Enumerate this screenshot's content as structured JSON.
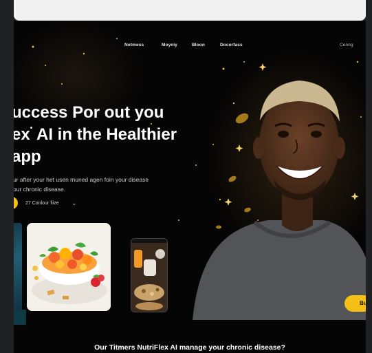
{
  "nav": {
    "items": [
      {
        "label": "Notmess"
      },
      {
        "label": "Moyniy"
      },
      {
        "label": "Bloon"
      },
      {
        "label": "Docorfass"
      }
    ],
    "account": "Cenng"
  },
  "hero": {
    "title_lines": [
      "uccess Por out you",
      "ex",
      "AI in the Healthier",
      "app"
    ],
    "subtitle_lines": [
      "ur after your het usen muned agen foin your disease",
      "our chronic disease."
    ],
    "count_label": "27 Conlour fiize"
  },
  "cta": {
    "label": "Bu"
  },
  "footer": {
    "title": "Our Titmers NutriFlex AI manage your chronic disease?"
  },
  "colors": {
    "accent": "#f5bf16",
    "background": "#060505",
    "text": "#ffffff"
  },
  "icons": [
    "chevron-down-icon",
    "star-icon",
    "salad-image-icon",
    "phone-image-icon",
    "person-photo-icon"
  ]
}
